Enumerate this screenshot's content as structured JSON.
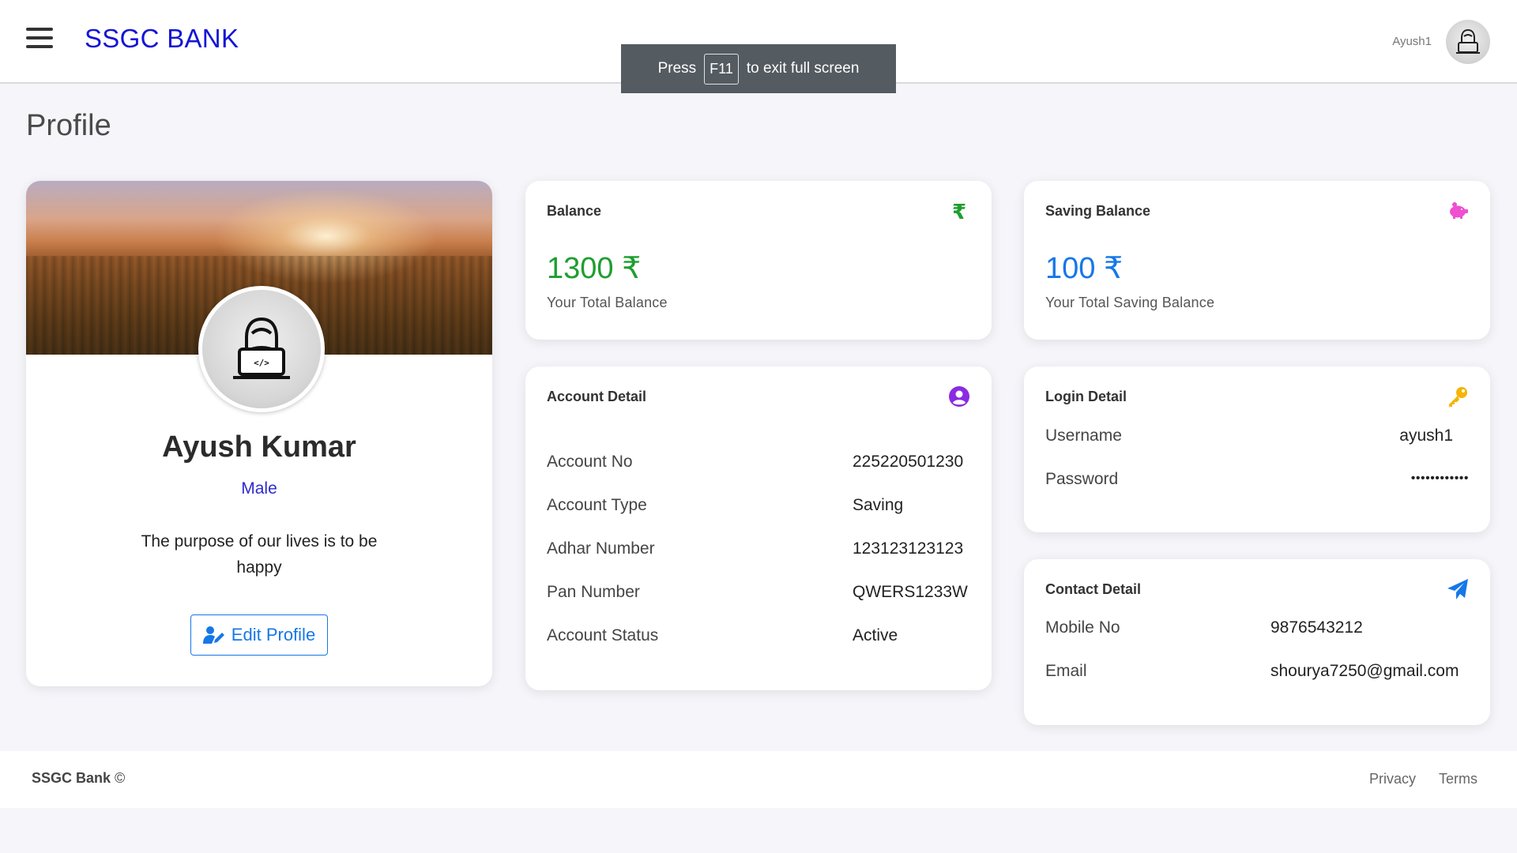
{
  "header": {
    "brand": "SSGC BANK",
    "username": "Ayush1"
  },
  "fullscreen_notice": {
    "press": "Press",
    "key": "F11",
    "suffix": "to exit full screen"
  },
  "page_title": "Profile",
  "profile": {
    "name": "Ayush Kumar",
    "gender": "Male",
    "bio": "The purpose of our lives is to be happy",
    "edit_label": "Edit Profile"
  },
  "balance": {
    "title": "Balance",
    "amount": "1300 ₹",
    "subtitle": "Your Total Balance",
    "color": "#1e9e2f"
  },
  "saving": {
    "title": "Saving Balance",
    "amount": "100 ₹",
    "subtitle": "Your Total Saving Balance",
    "color": "#1677e8"
  },
  "account": {
    "title": "Account Detail",
    "rows": [
      {
        "label": "Account No",
        "value": "225220501230"
      },
      {
        "label": "Account Type",
        "value": "Saving"
      },
      {
        "label": "Adhar Number",
        "value": "123123123123"
      },
      {
        "label": "Pan Number",
        "value": "QWERS1233W"
      },
      {
        "label": "Account Status",
        "value": "Active"
      }
    ]
  },
  "login": {
    "title": "Login Detail",
    "rows": [
      {
        "label": "Username",
        "value": "ayush1"
      },
      {
        "label": "Password",
        "value": "••••••••••••"
      }
    ]
  },
  "contact": {
    "title": "Contact Detail",
    "rows": [
      {
        "label": "Mobile No",
        "value": "9876543212"
      },
      {
        "label": "Email",
        "value": "shourya7250@gmail.com"
      }
    ]
  },
  "footer": {
    "brand": "SSGC Bank",
    "copyright": "©",
    "links": [
      "Privacy",
      "Terms"
    ]
  },
  "icons": {
    "balance": "rupee-icon",
    "saving": "piggy-bank-icon",
    "account": "user-circle-icon",
    "login": "key-icon",
    "contact": "paper-plane-icon",
    "edit": "user-edit-icon",
    "menu": "hamburger-menu-icon"
  }
}
